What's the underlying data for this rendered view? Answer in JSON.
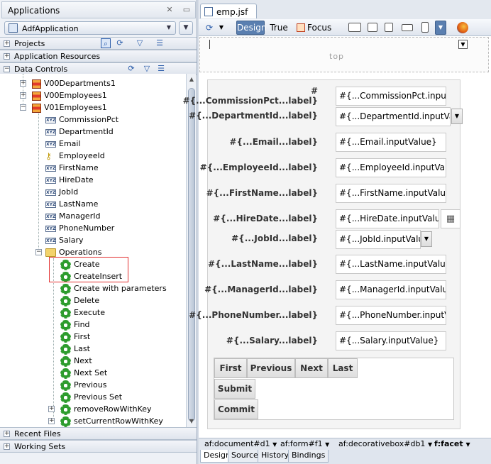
{
  "left": {
    "title": "Applications",
    "app_selector": "AdfApplication",
    "sections": {
      "projects": "Projects",
      "app_resources": "Application Resources",
      "data_controls": "Data Controls",
      "recent_files": "Recent Files",
      "working_sets": "Working Sets"
    },
    "tree": {
      "vos": [
        "V00Departments1",
        "V00Employees1",
        "V01Employees1"
      ],
      "attributes": [
        "CommissionPct",
        "DepartmentId",
        "Email",
        "EmployeeId",
        "FirstName",
        "HireDate",
        "JobId",
        "LastName",
        "ManagerId",
        "PhoneNumber",
        "Salary"
      ],
      "operations_folder": "Operations",
      "operations": [
        "Create",
        "CreateInsert",
        "Create with parameters",
        "Delete",
        "Execute",
        "Find",
        "First",
        "Last",
        "Next",
        "Next Set",
        "Previous",
        "Previous Set",
        "removeRowWithKey",
        "setCurrentRowWithKey"
      ]
    }
  },
  "editor": {
    "tab": "emp.jsf",
    "toolbar": {
      "design": "Design",
      "true": "True",
      "focus": "Focus"
    },
    "top_facet": "top",
    "fields": [
      {
        "label": "#{...CommissionPct...label}",
        "value": "#{...CommissionPct.inputValue}"
      },
      {
        "label": "#{...DepartmentId...label}",
        "value": "#{...DepartmentId.inputValue}"
      },
      {
        "label": "#{...Email...label}",
        "value": "#{...Email.inputValue}"
      },
      {
        "label": "#{...EmployeeId...label}",
        "value": "#{...EmployeeId.inputValue}"
      },
      {
        "label": "#{...FirstName...label}",
        "value": "#{...FirstName.inputValue}"
      },
      {
        "label": "#{...HireDate...label}",
        "value": "#{...HireDate.inputValue}"
      },
      {
        "label": "#{...JobId...label}",
        "value": "#{...JobId.inputValue}"
      },
      {
        "label": "#{...LastName...label}",
        "value": "#{...LastName.inputValue}"
      },
      {
        "label": "#{...ManagerId...label}",
        "value": "#{...ManagerId.inputValue}"
      },
      {
        "label": "#{...PhoneNumber...label}",
        "value": "#{...PhoneNumber.inputValue}"
      },
      {
        "label": "#{...Salary...label}",
        "value": "#{...Salary.inputValue}"
      }
    ],
    "buttons": {
      "first": "First",
      "previous": "Previous",
      "next": "Next",
      "last": "Last",
      "submit": "Submit",
      "commit": "Commit"
    },
    "breadcrumbs": [
      "af:document#d1",
      "af:form#f1",
      "af:decorativebox#db1",
      "f:facet"
    ],
    "bottom_tabs": [
      "Design",
      "Source",
      "History",
      "Bindings"
    ]
  }
}
